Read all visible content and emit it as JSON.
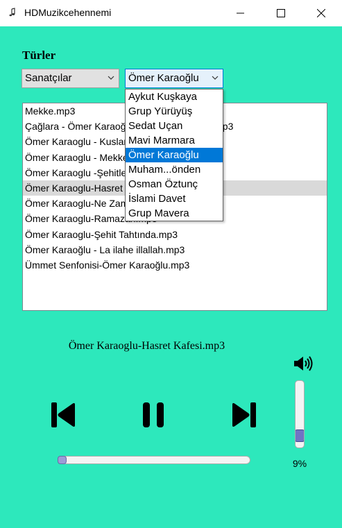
{
  "window": {
    "title": "HDMuzikcehennemi"
  },
  "labels": {
    "genres": "Türler"
  },
  "category_combo": {
    "value": "Sanatçılar"
  },
  "artist_combo": {
    "value": "Ömer Karaoğlu",
    "options": [
      "Aykut Kuşkaya",
      "Grup Yürüyüş",
      "Sedat Uçan",
      "Mavi Marmara",
      "Ömer Karaoğlu",
      "Muham...önden",
      "Osman Öztunç",
      "İslami Davet",
      "Grup Mavera"
    ],
    "selected_index": 4
  },
  "tracks": {
    "items": [
      "Mekke.mp3",
      "Çağlara - Ömer Karaoğlu ft Hüseyin Balcan.mp3",
      "Ömer Karaoglu - Kuslar.mp3",
      "Ömer Karaoglu - Mekke.mp3",
      "Ömer Karaoglu -Şehitler.mp3",
      "Ömer Karaoglu-Hasret Kafesi.mp3",
      "Ömer Karaoglu-Ne Zaman.mp3",
      "Ömer Karaoglu-Ramazan.mp3",
      "Ömer Karaoglu-Şehit Tahtında.mp3",
      "Ömer Karaoğlu - La ilahe illallah.mp3",
      "Ümmet Senfonisi-Ömer Karaoğlu.mp3"
    ],
    "selected_index": 5
  },
  "player": {
    "now_playing": "Ömer Karaoglu-Hasret Kafesi.mp3",
    "progress_fraction": 0.0,
    "volume_percent": 9,
    "volume_label": "9%"
  },
  "colors": {
    "background": "#2de8bc",
    "selection": "#0078d7",
    "track_highlight": "#d9d9d9"
  },
  "icons": {
    "app": "music-note-icon",
    "speaker": "speaker-icon",
    "previous": "skip-previous-icon",
    "pause": "pause-icon",
    "next": "skip-next-icon"
  }
}
